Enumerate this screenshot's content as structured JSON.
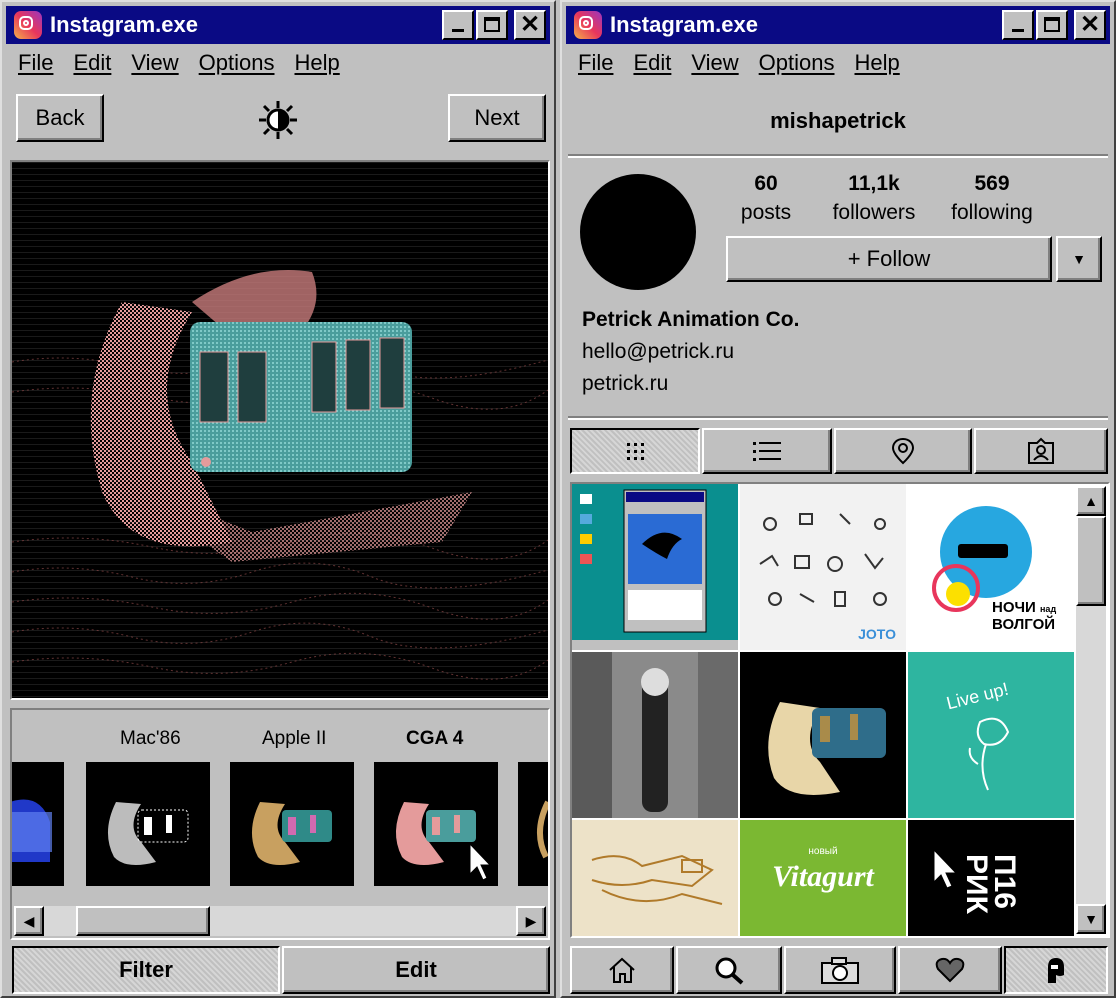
{
  "left_window": {
    "title": "Instagram.exe",
    "menu": [
      "File",
      "Edit",
      "View",
      "Options",
      "Help"
    ],
    "back_label": "Back",
    "next_label": "Next",
    "filters": [
      {
        "label": "Mac'86",
        "selected": false
      },
      {
        "label": "Apple II",
        "selected": false
      },
      {
        "label": "CGA 4",
        "selected": true
      }
    ],
    "tabs": {
      "filter": "Filter",
      "edit": "Edit"
    }
  },
  "right_window": {
    "title": "Instagram.exe",
    "menu": [
      "File",
      "Edit",
      "View",
      "Options",
      "Help"
    ],
    "username": "mishapetrick",
    "stats": {
      "posts": {
        "value": "60",
        "label": "posts"
      },
      "followers": {
        "value": "11,1k",
        "label": "followers"
      },
      "following": {
        "value": "569",
        "label": "following"
      }
    },
    "follow_label": "+ Follow",
    "bio": {
      "name": "Petrick Animation Co.",
      "email": "hello@petrick.ru",
      "website": "petrick.ru"
    },
    "grid_texts": {
      "joto": "JOTO",
      "nochi": "НОЧИ",
      "nad": "над",
      "volgoy": "ВОЛГОЙ",
      "live_up": "Live up!",
      "vitagurt_small": "новый",
      "vitagurt": "Vitagurt",
      "p16": "П16",
      "rik": "РИК"
    }
  },
  "colors": {
    "titlebar": "#0a0a84",
    "window_face": "#c0c0c0",
    "teal": "#2eb5a0",
    "lime": "#7bb832"
  }
}
